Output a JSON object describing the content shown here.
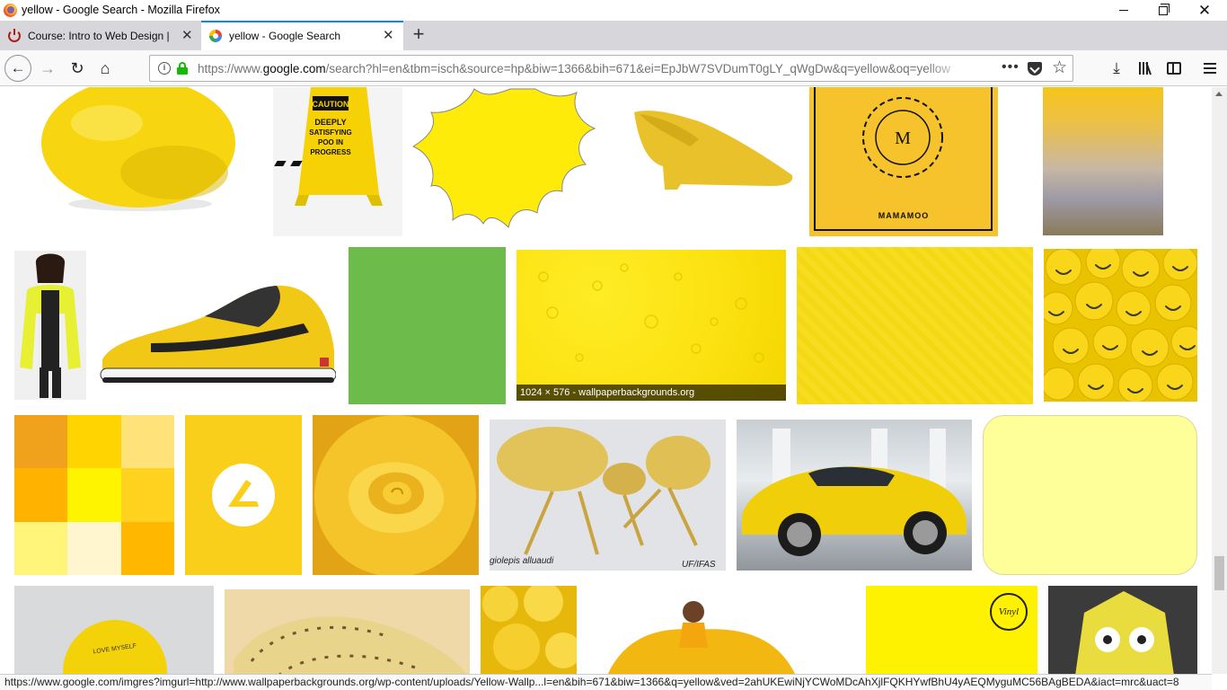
{
  "window": {
    "title": "yellow - Google Search - Mozilla Firefox"
  },
  "tabs": [
    {
      "label": "Course: Intro to Web Design | S",
      "active": false
    },
    {
      "label": "yellow - Google Search",
      "active": true
    }
  ],
  "urlbar": {
    "url_prefix": "https://www.",
    "url_domain": "google.com",
    "url_rest": "/search?hl=en&tbm=isch&source=hp&biw=1366&bih=671&ei=EpJbW7SVDumT0gLY_qWgDw&q=yellow&oq=yellow"
  },
  "images": {
    "wallpaper_caption": "1024 × 576 - wallpaperbackgrounds.org",
    "sign_caution": "CAUTION",
    "sign_text": "DEEPLY SATISFYING POO IN PROGRESS",
    "mamamoo_label": "MAMAMOO",
    "ant_species": "giolepis alluaudi",
    "ant_credit": "UF/IFAS",
    "ball_text": "LOVE MYSELF",
    "vinyl_text": "Vinyl"
  },
  "status": {
    "link": "https://www.google.com/imgres?imgurl=http://www.wallpaperbackgrounds.org/wp-content/uploads/Yellow-Wallp...l=en&bih=671&biw=1366&q=yellow&ved=2ahUKEwiNjYCWoMDcAhXjlFQKHYwfBhU4yAEQMyguMC56BAgBEDA&iact=mrc&uact=8"
  },
  "colors": {
    "accent": "#0a84ff",
    "secure_lock": "#12bc00",
    "lemon": "#f7d511",
    "green_swatch": "#6cbb4b"
  },
  "icons": [
    "firefox-icon",
    "minimize-icon",
    "maximize-icon",
    "close-icon",
    "tab-close-icon",
    "new-tab-icon",
    "back-arrow-icon",
    "forward-arrow-icon",
    "reload-icon",
    "home-icon",
    "info-icon",
    "lock-icon",
    "page-actions-icon",
    "pocket-icon",
    "bookmark-star-icon",
    "download-icon",
    "library-icon",
    "sidebar-icon",
    "hamburger-menu-icon"
  ]
}
